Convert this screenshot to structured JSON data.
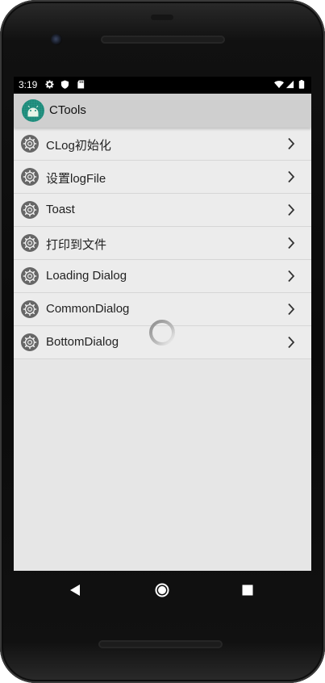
{
  "status_bar": {
    "time": "3:19",
    "left_icons": [
      "gear-icon",
      "shield-icon",
      "sd-card-icon"
    ],
    "right_icons": [
      "wifi-icon",
      "signal-icon",
      "battery-icon"
    ]
  },
  "app": {
    "title": "CTools",
    "logo_icon": "android-icon",
    "accent": "#1f8a7a"
  },
  "menu": {
    "items": [
      {
        "label": "CLog初始化",
        "icon": "gear-icon"
      },
      {
        "label": "设置logFile",
        "icon": "gear-icon"
      },
      {
        "label": "Toast",
        "icon": "gear-icon"
      },
      {
        "label": "打印到文件",
        "icon": "gear-icon"
      },
      {
        "label": "Loading Dialog",
        "icon": "gear-icon"
      },
      {
        "label": "CommonDialog",
        "icon": "gear-icon"
      },
      {
        "label": "BottomDialog",
        "icon": "gear-icon"
      }
    ]
  },
  "loading": {
    "icon": "loading-spinner"
  },
  "nav_bar": {
    "buttons": [
      "back-icon",
      "home-icon",
      "recents-icon"
    ]
  }
}
